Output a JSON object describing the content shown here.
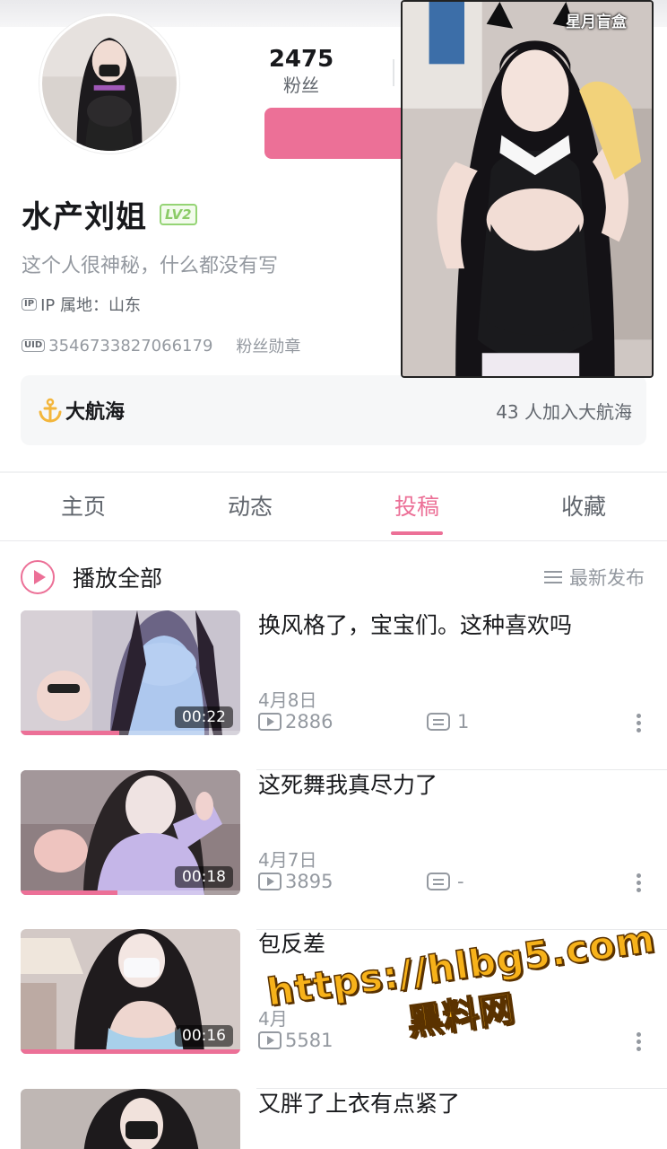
{
  "profile": {
    "username": "水产刘姐",
    "level": "LV2",
    "bio": "这个人很神秘，什么都没有写",
    "ip_tag": "IP",
    "ip_location": "IP 属地：山东",
    "uid_tag": "UID",
    "uid": "3546733827066179",
    "fan_medal": "粉丝勋章"
  },
  "stats": {
    "followers_count": "2475",
    "followers_label": "粉丝"
  },
  "floating_ad": {
    "title": "星月盲盒"
  },
  "guard": {
    "title": "大航海",
    "count_text": "43 人加入大航海"
  },
  "tabs": [
    {
      "label": "主页",
      "active": false
    },
    {
      "label": "动态",
      "active": false
    },
    {
      "label": "投稿",
      "active": true
    },
    {
      "label": "收藏",
      "active": false
    }
  ],
  "list_header": {
    "play_all": "播放全部",
    "sort": "最新发布"
  },
  "videos": [
    {
      "title": "换风格了，宝宝们。这种喜欢吗",
      "date": "4月8日",
      "plays": "2886",
      "comments": "1",
      "duration": "00:22",
      "watched_fraction": 0.45
    },
    {
      "title": "这死舞我真尽力了",
      "date": "4月7日",
      "plays": "3895",
      "comments": "-",
      "duration": "00:18",
      "watched_fraction": 0.44
    },
    {
      "title": "包反差",
      "date": "4月",
      "plays": "5581",
      "comments": "",
      "duration": "00:16",
      "watched_fraction": 1.0
    },
    {
      "title": "又胖了上衣有点紧了",
      "date": "",
      "plays": "",
      "comments": "",
      "duration": "",
      "watched_fraction": 0
    }
  ],
  "watermark": {
    "url": "https://hlbg5.com",
    "name": "黑料网"
  },
  "colors": {
    "accent": "#ec7097",
    "level_green": "#8bcb67",
    "text_primary": "#18191c",
    "text_secondary": "#61666d",
    "text_muted": "#9499a0",
    "watermark": "#f7b21a"
  }
}
